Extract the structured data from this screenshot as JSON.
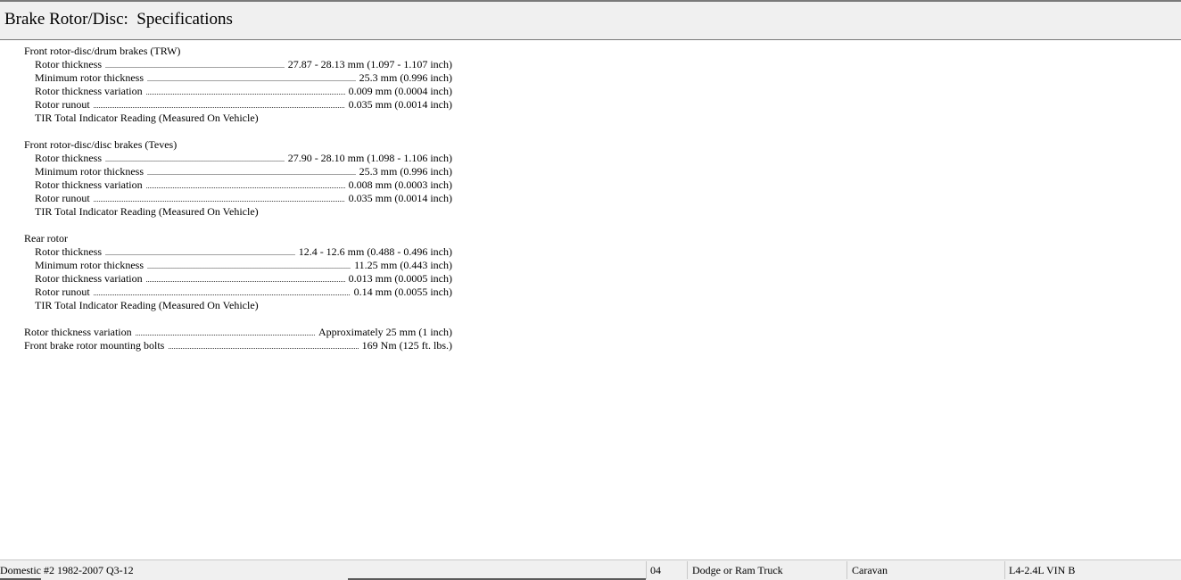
{
  "header": {
    "title": "Brake Rotor/Disc:  Specifications"
  },
  "sections": [
    {
      "title": "Front rotor-disc/drum brakes (TRW)",
      "rows": [
        {
          "label": "Rotor thickness",
          "value": "27.87 - 28.13 mm (1.097 - 1.107 inch)"
        },
        {
          "label": "Minimum rotor thickness",
          "value": "25.3 mm (0.996 inch)"
        },
        {
          "label": "Rotor thickness variation",
          "value": "0.009 mm (0.0004 inch)"
        },
        {
          "label": "Rotor runout",
          "value": "0.035 mm (0.0014 inch)"
        }
      ],
      "note": "TIR Total Indicator Reading (Measured On Vehicle)"
    },
    {
      "title": "Front rotor-disc/disc brakes (Teves)",
      "rows": [
        {
          "label": "Rotor thickness",
          "value": "27.90 - 28.10 mm (1.098 - 1.106 inch)"
        },
        {
          "label": "Minimum rotor thickness",
          "value": "25.3 mm (0.996 inch)"
        },
        {
          "label": "Rotor thickness variation",
          "value": "0.008 mm (0.0003 inch)"
        },
        {
          "label": "Rotor runout",
          "value": "0.035 mm (0.0014 inch)"
        }
      ],
      "note": "TIR Total Indicator Reading (Measured On Vehicle)"
    },
    {
      "title": "Rear rotor",
      "rows": [
        {
          "label": "Rotor thickness",
          "value": "12.4 - 12.6 mm (0.488 - 0.496 inch)"
        },
        {
          "label": "Minimum rotor thickness",
          "value": "11.25 mm (0.443 inch)"
        },
        {
          "label": "Rotor thickness variation",
          "value": "0.013 mm (0.0005 inch)"
        },
        {
          "label": "Rotor runout",
          "value": "0.14 mm (0.0055 inch)"
        }
      ],
      "note": "TIR Total Indicator Reading (Measured On Vehicle)"
    }
  ],
  "general": [
    {
      "label": "Rotor thickness variation",
      "value": "Approximately 25 mm (1 inch)"
    },
    {
      "label": "Front brake rotor mounting bolts",
      "value": "169 Nm (125 ft. lbs.)"
    }
  ],
  "statusbar": {
    "database": "Domestic #2 1982-2007 Q3-12",
    "year": "04",
    "make": "Dodge or Ram Truck",
    "model": "Caravan",
    "engine": "L4-2.4L VIN B"
  }
}
